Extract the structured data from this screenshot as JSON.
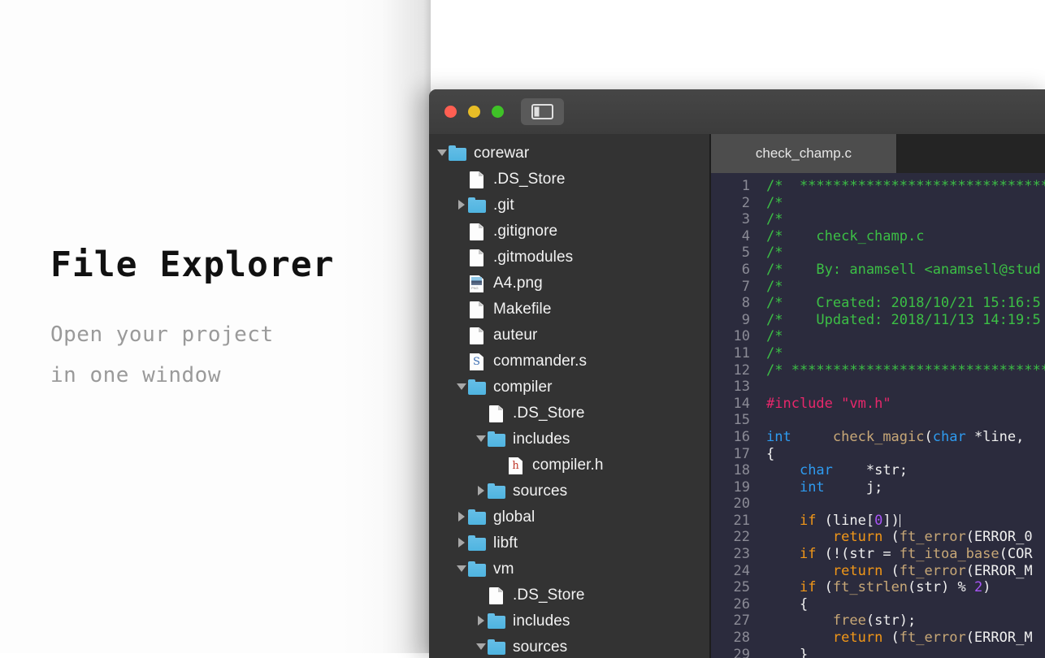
{
  "promo": {
    "title": "File Explorer",
    "subtitle_lines": [
      "Open your project",
      "in one window"
    ]
  },
  "window": {
    "traffic_lights": [
      {
        "name": "close",
        "color": "#ff5f52"
      },
      {
        "name": "minimize",
        "color": "#e8bd26"
      },
      {
        "name": "maximize",
        "color": "#3fc227"
      }
    ],
    "sidebar_toggle_icon": "sidebar-toggle-icon"
  },
  "sidebar": {
    "tree": [
      {
        "depth": 0,
        "twisty": "open",
        "icon": "folder",
        "label": "corewar"
      },
      {
        "depth": 1,
        "twisty": "none",
        "icon": "file",
        "label": ".DS_Store"
      },
      {
        "depth": 1,
        "twisty": "closed",
        "icon": "folder",
        "label": ".git"
      },
      {
        "depth": 1,
        "twisty": "none",
        "icon": "file",
        "label": ".gitignore"
      },
      {
        "depth": 1,
        "twisty": "none",
        "icon": "file",
        "label": ".gitmodules"
      },
      {
        "depth": 1,
        "twisty": "none",
        "icon": "png",
        "label": "A4.png"
      },
      {
        "depth": 1,
        "twisty": "none",
        "icon": "file",
        "label": "Makefile"
      },
      {
        "depth": 1,
        "twisty": "none",
        "icon": "file",
        "label": "auteur"
      },
      {
        "depth": 1,
        "twisty": "none",
        "icon": "sfile",
        "label": "commander.s"
      },
      {
        "depth": 1,
        "twisty": "open",
        "icon": "folder",
        "label": "compiler"
      },
      {
        "depth": 2,
        "twisty": "none",
        "icon": "file",
        "label": ".DS_Store"
      },
      {
        "depth": 2,
        "twisty": "open",
        "icon": "folder",
        "label": "includes"
      },
      {
        "depth": 3,
        "twisty": "none",
        "icon": "hfile",
        "label": "compiler.h"
      },
      {
        "depth": 2,
        "twisty": "closed",
        "icon": "folder",
        "label": "sources"
      },
      {
        "depth": 1,
        "twisty": "closed",
        "icon": "folder",
        "label": "global"
      },
      {
        "depth": 1,
        "twisty": "closed",
        "icon": "folder",
        "label": "libft"
      },
      {
        "depth": 1,
        "twisty": "open",
        "icon": "folder",
        "label": "vm"
      },
      {
        "depth": 2,
        "twisty": "none",
        "icon": "file",
        "label": ".DS_Store"
      },
      {
        "depth": 2,
        "twisty": "closed",
        "icon": "folder",
        "label": "includes"
      },
      {
        "depth": 2,
        "twisty": "open",
        "icon": "folder",
        "label": "sources"
      }
    ]
  },
  "editor": {
    "tabs": [
      {
        "label": "check_champ.c",
        "active": true
      },
      {
        "label": "",
        "active": false
      }
    ],
    "lines": [
      {
        "n": 1,
        "tokens": [
          {
            "c": "cm",
            "t": "/*  ************************************"
          }
        ]
      },
      {
        "n": 2,
        "tokens": [
          {
            "c": "cm",
            "t": "/*"
          }
        ]
      },
      {
        "n": 3,
        "tokens": [
          {
            "c": "cm",
            "t": "/*"
          }
        ]
      },
      {
        "n": 4,
        "tokens": [
          {
            "c": "cm",
            "t": "/*    check_champ.c"
          }
        ]
      },
      {
        "n": 5,
        "tokens": [
          {
            "c": "cm",
            "t": "/*"
          }
        ]
      },
      {
        "n": 6,
        "tokens": [
          {
            "c": "cm",
            "t": "/*    By: anamsell <anamsell@stud"
          }
        ]
      },
      {
        "n": 7,
        "tokens": [
          {
            "c": "cm",
            "t": "/*"
          }
        ]
      },
      {
        "n": 8,
        "tokens": [
          {
            "c": "cm",
            "t": "/*    Created: 2018/10/21 15:16:5"
          }
        ]
      },
      {
        "n": 9,
        "tokens": [
          {
            "c": "cm",
            "t": "/*    Updated: 2018/11/13 14:19:5"
          }
        ]
      },
      {
        "n": 10,
        "tokens": [
          {
            "c": "cm",
            "t": "/*"
          }
        ]
      },
      {
        "n": 11,
        "tokens": [
          {
            "c": "cm",
            "t": "/*"
          }
        ]
      },
      {
        "n": 12,
        "tokens": [
          {
            "c": "cm",
            "t": "/* *************************************"
          }
        ]
      },
      {
        "n": 13,
        "tokens": []
      },
      {
        "n": 14,
        "tokens": [
          {
            "c": "pp",
            "t": "#include"
          },
          {
            "c": "pl",
            "t": " "
          },
          {
            "c": "str",
            "t": "\"vm.h\""
          }
        ]
      },
      {
        "n": 15,
        "tokens": []
      },
      {
        "n": 16,
        "tokens": [
          {
            "c": "kw",
            "t": "int"
          },
          {
            "c": "pl",
            "t": "     "
          },
          {
            "c": "fn",
            "t": "check_magic"
          },
          {
            "c": "pl",
            "t": "("
          },
          {
            "c": "kw",
            "t": "char"
          },
          {
            "c": "pl",
            "t": " *line, "
          }
        ]
      },
      {
        "n": 17,
        "tokens": [
          {
            "c": "pl",
            "t": "{"
          }
        ]
      },
      {
        "n": 18,
        "tokens": [
          {
            "c": "pl",
            "t": "    "
          },
          {
            "c": "kw",
            "t": "char"
          },
          {
            "c": "pl",
            "t": "    *str;"
          }
        ]
      },
      {
        "n": 19,
        "tokens": [
          {
            "c": "pl",
            "t": "    "
          },
          {
            "c": "kw",
            "t": "int"
          },
          {
            "c": "pl",
            "t": "     j;"
          }
        ]
      },
      {
        "n": 20,
        "tokens": []
      },
      {
        "n": 21,
        "tokens": [
          {
            "c": "pl",
            "t": "    "
          },
          {
            "c": "ctl",
            "t": "if"
          },
          {
            "c": "pl",
            "t": " (line["
          },
          {
            "c": "num",
            "t": "0"
          },
          {
            "c": "pl",
            "t": "])"
          }
        ],
        "cursor": true
      },
      {
        "n": 22,
        "tokens": [
          {
            "c": "pl",
            "t": "        "
          },
          {
            "c": "ctl",
            "t": "return"
          },
          {
            "c": "pl",
            "t": " ("
          },
          {
            "c": "fn",
            "t": "ft_error"
          },
          {
            "c": "pl",
            "t": "(ERROR_0"
          }
        ]
      },
      {
        "n": 23,
        "tokens": [
          {
            "c": "pl",
            "t": "    "
          },
          {
            "c": "ctl",
            "t": "if"
          },
          {
            "c": "pl",
            "t": " (!(str = "
          },
          {
            "c": "fn",
            "t": "ft_itoa_base"
          },
          {
            "c": "pl",
            "t": "(COR"
          }
        ]
      },
      {
        "n": 24,
        "tokens": [
          {
            "c": "pl",
            "t": "        "
          },
          {
            "c": "ctl",
            "t": "return"
          },
          {
            "c": "pl",
            "t": " ("
          },
          {
            "c": "fn",
            "t": "ft_error"
          },
          {
            "c": "pl",
            "t": "(ERROR_M"
          }
        ]
      },
      {
        "n": 25,
        "tokens": [
          {
            "c": "pl",
            "t": "    "
          },
          {
            "c": "ctl",
            "t": "if"
          },
          {
            "c": "pl",
            "t": " ("
          },
          {
            "c": "fn",
            "t": "ft_strlen"
          },
          {
            "c": "pl",
            "t": "(str) % "
          },
          {
            "c": "num",
            "t": "2"
          },
          {
            "c": "pl",
            "t": ")"
          }
        ]
      },
      {
        "n": 26,
        "tokens": [
          {
            "c": "pl",
            "t": "    {"
          }
        ]
      },
      {
        "n": 27,
        "tokens": [
          {
            "c": "pl",
            "t": "        "
          },
          {
            "c": "fn",
            "t": "free"
          },
          {
            "c": "pl",
            "t": "(str);"
          }
        ]
      },
      {
        "n": 28,
        "tokens": [
          {
            "c": "pl",
            "t": "        "
          },
          {
            "c": "ctl",
            "t": "return"
          },
          {
            "c": "pl",
            "t": " ("
          },
          {
            "c": "fn",
            "t": "ft_error"
          },
          {
            "c": "pl",
            "t": "(ERROR_M"
          }
        ]
      },
      {
        "n": 29,
        "tokens": [
          {
            "c": "pl",
            "t": "    }"
          }
        ]
      }
    ]
  }
}
